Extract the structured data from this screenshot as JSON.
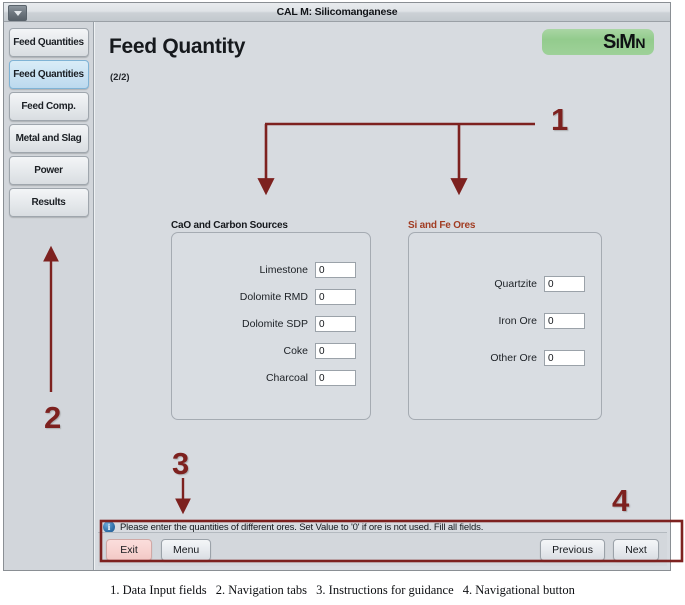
{
  "window": {
    "title": "CAL M: Silicomanganese",
    "menu_icon": "caret-down-icon"
  },
  "sidebar": {
    "tabs": [
      {
        "label": "Feed Quantities",
        "selected": false
      },
      {
        "label": "Feed Quantities",
        "selected": true
      },
      {
        "label": "Feed Comp.",
        "selected": false
      },
      {
        "label": "Metal and Slag",
        "selected": false
      },
      {
        "label": "Power",
        "selected": false
      },
      {
        "label": "Results",
        "selected": false
      }
    ]
  },
  "content": {
    "page_title": "Feed Quantity",
    "page_counter": "(2/2)",
    "brand": "SiMn",
    "groups": [
      {
        "label": "CaO and Carbon Sources",
        "label_color": "#15181c",
        "fields": [
          {
            "label": "Limestone",
            "value": "0"
          },
          {
            "label": "Dolomite RMD",
            "value": "0"
          },
          {
            "label": "Dolomite SDP",
            "value": "0"
          },
          {
            "label": "Coke",
            "value": "0"
          },
          {
            "label": "Charcoal",
            "value": "0"
          }
        ]
      },
      {
        "label": "Si and Fe Ores",
        "label_color": "#a13c22",
        "fields": [
          {
            "label": "Quartzite",
            "value": "0"
          },
          {
            "label": "Iron Ore",
            "value": "0"
          },
          {
            "label": "Other Ore",
            "value": "0"
          }
        ]
      }
    ],
    "info": {
      "icon": "info-circle-icon",
      "icon_glyph": "i",
      "text": "Please enter the quantities of different ores. Set Value to '0' if ore is not used. Fill all fields."
    },
    "buttons": {
      "exit": "Exit",
      "menu": "Menu",
      "previous": "Previous",
      "next": "Next"
    }
  },
  "annotations": {
    "color": "#7d211f",
    "markers": [
      {
        "id": "1",
        "label": "1"
      },
      {
        "id": "2",
        "label": "2"
      },
      {
        "id": "3",
        "label": "3"
      },
      {
        "id": "4",
        "label": "4"
      }
    ]
  },
  "caption": {
    "items": [
      "1.   Data Input fields",
      "2. Navigation tabs",
      "3. Instructions for guidance",
      "4. Navigational button"
    ]
  }
}
